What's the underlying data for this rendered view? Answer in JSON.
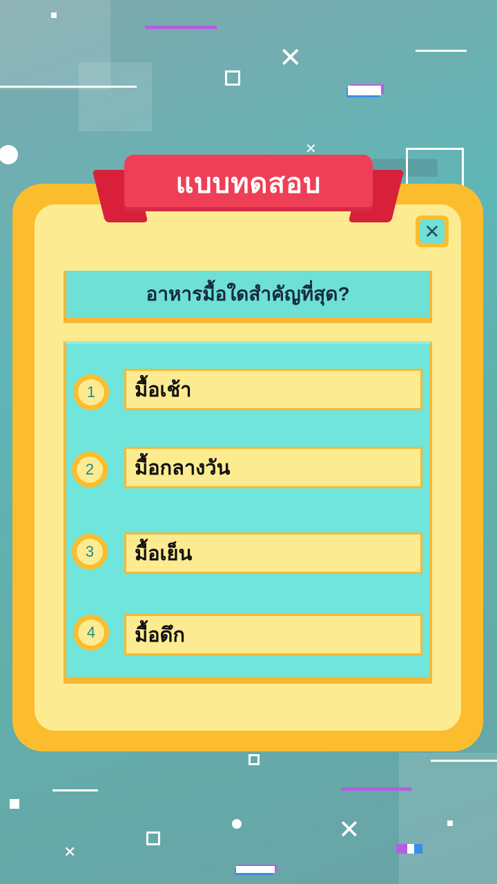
{
  "title": "แบบทดสอบ",
  "question": "อาหารมื้อใดสำคัญที่สุด?",
  "options": [
    {
      "number": "1",
      "label": "มื้อเช้า"
    },
    {
      "number": "2",
      "label": "มื้อกลางวัน"
    },
    {
      "number": "3",
      "label": "มื้อเย็น"
    },
    {
      "number": "4",
      "label": "มื้อดึก"
    }
  ],
  "icons": {
    "close": "close-icon",
    "background_cross": "cross-icon",
    "background_square": "square-icon"
  },
  "colors": {
    "board": "#fbbd2e",
    "board_inner": "#fdeb91",
    "ribbon": "#ef3f56",
    "panel": "#6fe0d6",
    "accent_purple": "#b45ee0"
  }
}
